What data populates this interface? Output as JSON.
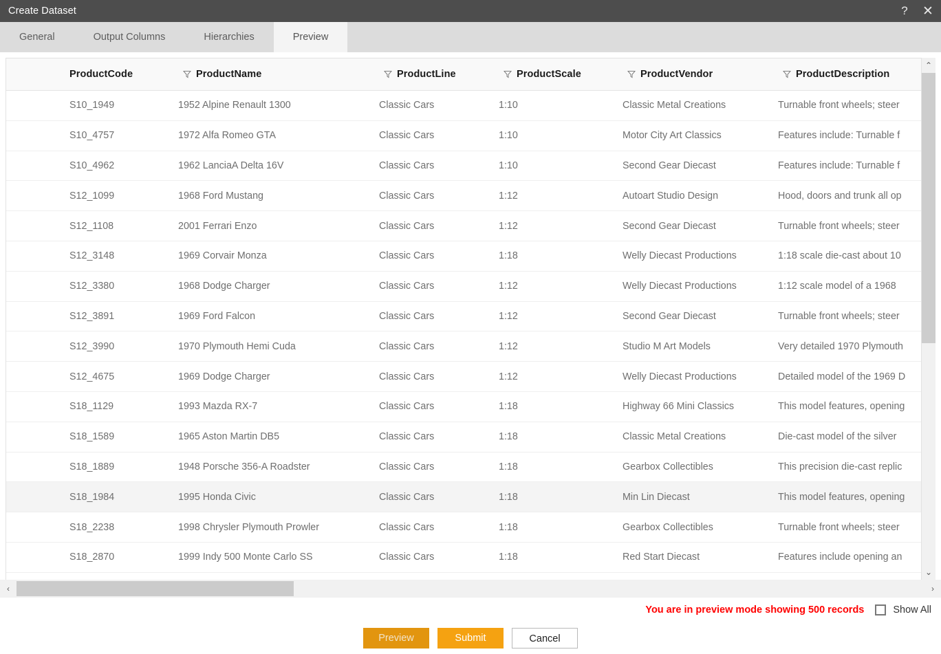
{
  "window": {
    "title": "Create Dataset",
    "help_icon": "?",
    "close_icon": "✕"
  },
  "tabs": [
    {
      "label": "General",
      "active": false
    },
    {
      "label": "Output Columns",
      "active": false
    },
    {
      "label": "Hierarchies",
      "active": false
    },
    {
      "label": "Preview",
      "active": true
    }
  ],
  "grid": {
    "columns": [
      {
        "key": "ProductCode",
        "label": "ProductCode",
        "filter": false
      },
      {
        "key": "ProductName",
        "label": "ProductName",
        "filter": true
      },
      {
        "key": "ProductLine",
        "label": "ProductLine",
        "filter": true
      },
      {
        "key": "ProductScale",
        "label": "ProductScale",
        "filter": true
      },
      {
        "key": "ProductVendor",
        "label": "ProductVendor",
        "filter": true
      },
      {
        "key": "ProductDescription",
        "label": "ProductDescription",
        "filter": true
      }
    ],
    "rows": [
      {
        "ProductCode": "S10_1949",
        "ProductName": "1952 Alpine Renault 1300",
        "ProductLine": "Classic Cars",
        "ProductScale": "1:10",
        "ProductVendor": "Classic Metal Creations",
        "ProductDescription": "Turnable front wheels; steer"
      },
      {
        "ProductCode": "S10_4757",
        "ProductName": "1972 Alfa Romeo GTA",
        "ProductLine": "Classic Cars",
        "ProductScale": "1:10",
        "ProductVendor": "Motor City Art Classics",
        "ProductDescription": "Features include: Turnable f"
      },
      {
        "ProductCode": "S10_4962",
        "ProductName": "1962 LanciaA Delta 16V",
        "ProductLine": "Classic Cars",
        "ProductScale": "1:10",
        "ProductVendor": "Second Gear Diecast",
        "ProductDescription": "Features include: Turnable f"
      },
      {
        "ProductCode": "S12_1099",
        "ProductName": "1968 Ford Mustang",
        "ProductLine": "Classic Cars",
        "ProductScale": "1:12",
        "ProductVendor": "Autoart Studio Design",
        "ProductDescription": "Hood, doors and trunk all op"
      },
      {
        "ProductCode": "S12_1108",
        "ProductName": "2001 Ferrari Enzo",
        "ProductLine": "Classic Cars",
        "ProductScale": "1:12",
        "ProductVendor": "Second Gear Diecast",
        "ProductDescription": "Turnable front wheels; steer"
      },
      {
        "ProductCode": "S12_3148",
        "ProductName": "1969 Corvair Monza",
        "ProductLine": "Classic Cars",
        "ProductScale": "1:18",
        "ProductVendor": "Welly Diecast Productions",
        "ProductDescription": "1:18 scale die-cast about 10"
      },
      {
        "ProductCode": "S12_3380",
        "ProductName": "1968 Dodge Charger",
        "ProductLine": "Classic Cars",
        "ProductScale": "1:12",
        "ProductVendor": "Welly Diecast Productions",
        "ProductDescription": "1:12 scale model of a 1968 "
      },
      {
        "ProductCode": "S12_3891",
        "ProductName": "1969 Ford Falcon",
        "ProductLine": "Classic Cars",
        "ProductScale": "1:12",
        "ProductVendor": "Second Gear Diecast",
        "ProductDescription": "Turnable front wheels; steer"
      },
      {
        "ProductCode": "S12_3990",
        "ProductName": "1970 Plymouth Hemi Cuda",
        "ProductLine": "Classic Cars",
        "ProductScale": "1:12",
        "ProductVendor": "Studio M Art Models",
        "ProductDescription": "Very detailed 1970 Plymouth"
      },
      {
        "ProductCode": "S12_4675",
        "ProductName": "1969 Dodge Charger",
        "ProductLine": "Classic Cars",
        "ProductScale": "1:12",
        "ProductVendor": "Welly Diecast Productions",
        "ProductDescription": "Detailed model of the 1969 D"
      },
      {
        "ProductCode": "S18_1129",
        "ProductName": "1993 Mazda RX-7",
        "ProductLine": "Classic Cars",
        "ProductScale": "1:18",
        "ProductVendor": "Highway 66 Mini Classics",
        "ProductDescription": "This model features, opening"
      },
      {
        "ProductCode": "S18_1589",
        "ProductName": "1965 Aston Martin DB5",
        "ProductLine": "Classic Cars",
        "ProductScale": "1:18",
        "ProductVendor": "Classic Metal Creations",
        "ProductDescription": "Die-cast model of the silver "
      },
      {
        "ProductCode": "S18_1889",
        "ProductName": "1948 Porsche 356-A Roadster",
        "ProductLine": "Classic Cars",
        "ProductScale": "1:18",
        "ProductVendor": "Gearbox Collectibles",
        "ProductDescription": "This precision die-cast replic"
      },
      {
        "ProductCode": "S18_1984",
        "ProductName": "1995 Honda Civic",
        "ProductLine": "Classic Cars",
        "ProductScale": "1:18",
        "ProductVendor": "Min Lin Diecast",
        "ProductDescription": "This model features, opening"
      },
      {
        "ProductCode": "S18_2238",
        "ProductName": "1998 Chrysler Plymouth Prowler",
        "ProductLine": "Classic Cars",
        "ProductScale": "1:18",
        "ProductVendor": "Gearbox Collectibles",
        "ProductDescription": "Turnable front wheels; steer"
      },
      {
        "ProductCode": "S18_2870",
        "ProductName": "1999 Indy 500 Monte Carlo SS",
        "ProductLine": "Classic Cars",
        "ProductScale": "1:18",
        "ProductVendor": "Red Start Diecast",
        "ProductDescription": "Features include opening an"
      }
    ],
    "highlighted_row_index": 13
  },
  "footer": {
    "status_message": "You are in preview mode showing 500 records",
    "show_all_label": "Show All",
    "show_all_checked": false
  },
  "buttons": {
    "preview": "Preview",
    "submit": "Submit",
    "cancel": "Cancel"
  },
  "icons": {
    "funnel": "filter-funnel-icon",
    "scroll_up": "⌃",
    "scroll_down": "⌄",
    "scroll_left": "‹",
    "scroll_right": "›"
  },
  "colors": {
    "titlebar": "#4d4d4d",
    "tabbar": "#dcdcdc",
    "active_tab": "#f4f4f4",
    "status_red": "#ff0000",
    "preview_button": "#e2950f",
    "submit_button": "#f5a211"
  }
}
